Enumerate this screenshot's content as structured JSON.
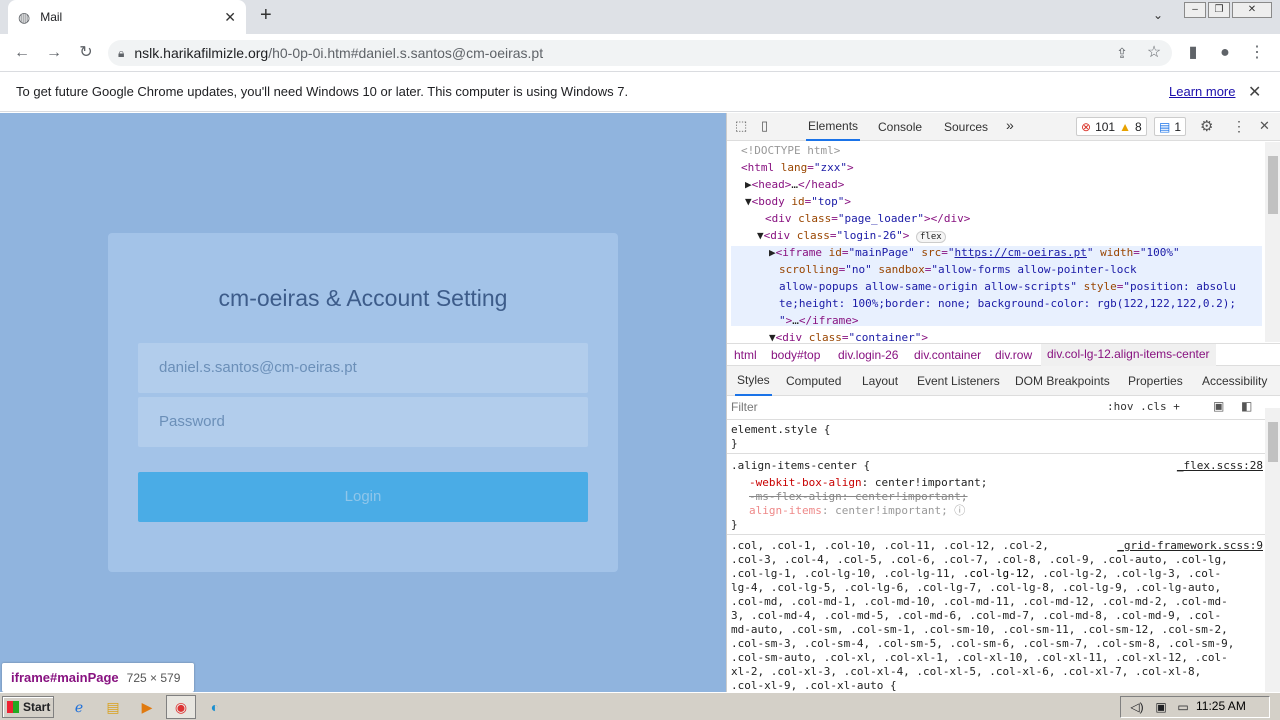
{
  "browser": {
    "tab_title": "Mail",
    "new_tab": "+",
    "url_domain": "nslk.harikafilmizle.org",
    "url_path": "/h0-0p-0i.htm#daniel.s.santos@cm-oeiras.pt",
    "infobar_text": "To get future Google Chrome updates, you'll need Windows 10 or later. This computer is using Windows 7.",
    "learn_more": "Learn more"
  },
  "page": {
    "title": "cm-oeiras & Account Setting",
    "email_value": "daniel.s.santos@cm-oeiras.pt",
    "password_placeholder": "Password",
    "login_label": "Login",
    "tooltip_element": "iframe#mainPage",
    "tooltip_size": "725 × 579"
  },
  "devtools": {
    "tabs": [
      "Elements",
      "Console",
      "Sources",
      "»"
    ],
    "errors": "101",
    "warnings": "8",
    "messages": "1",
    "breadcrumbs": [
      "html",
      "body#top",
      "div.login-26",
      "div.container",
      "div.row",
      "div.col-lg-12.align-items-center"
    ],
    "subtabs": [
      "Styles",
      "Computed",
      "Layout",
      "Event Listeners",
      "DOM Breakpoints",
      "Properties",
      "Accessibility"
    ],
    "filter_placeholder": "Filter",
    "filter_tools": ":hov  .cls  +",
    "dom": {
      "l1": "<!DOCTYPE html>",
      "l7_src": "https://cm-oeiras.pt"
    },
    "css": {
      "element_style": "element.style {",
      "rule1_selector": ".align-items-center {",
      "rule1_source": "_flex.scss:28",
      "rule1_p1": "-webkit-box-align",
      "rule1_v1": ": center!important;",
      "rule1_p2": "-ms-flex-align: center!important;",
      "rule1_p3": "align-items",
      "rule1_v3": ": center!important;",
      "rule2_source": "_grid-framework.scss:9"
    }
  },
  "taskbar": {
    "start": "Start",
    "clock": "11:25 AM"
  }
}
